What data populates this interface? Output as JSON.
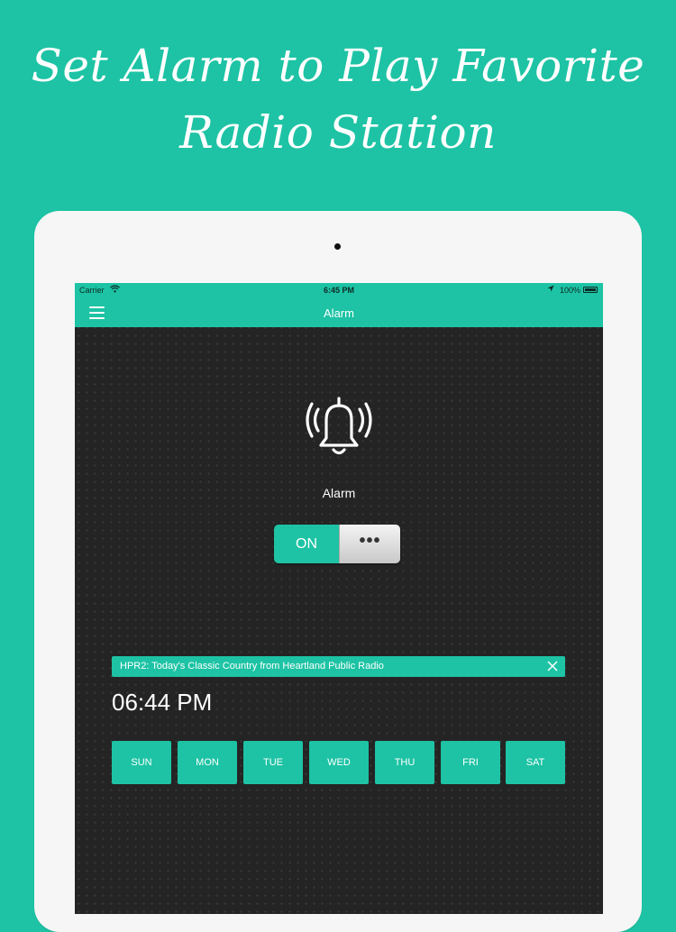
{
  "promo": {
    "line1": "Set Alarm to Play Favorite",
    "line2": "Radio Station"
  },
  "status_bar": {
    "carrier": "Carrier",
    "wifi_icon": "wifi-icon",
    "time": "6:45 PM",
    "location_icon": "location-arrow-icon",
    "battery": "100%"
  },
  "navbar": {
    "menu_icon": "hamburger-icon",
    "title": "Alarm"
  },
  "alarm": {
    "icon": "ringing-bell-icon",
    "label": "Alarm",
    "toggle_on_label": "ON",
    "toggle_handle": "•••",
    "station": "HPR2: Today's Classic Country from Heartland Public Radio",
    "close_icon": "close-icon",
    "time": "06:44 PM",
    "days": [
      "SUN",
      "MON",
      "TUE",
      "WED",
      "THU",
      "FRI",
      "SAT"
    ]
  },
  "colors": {
    "accent": "#1dc3a4",
    "screen_bg": "#242424",
    "device_frame": "#f6f6f6"
  }
}
